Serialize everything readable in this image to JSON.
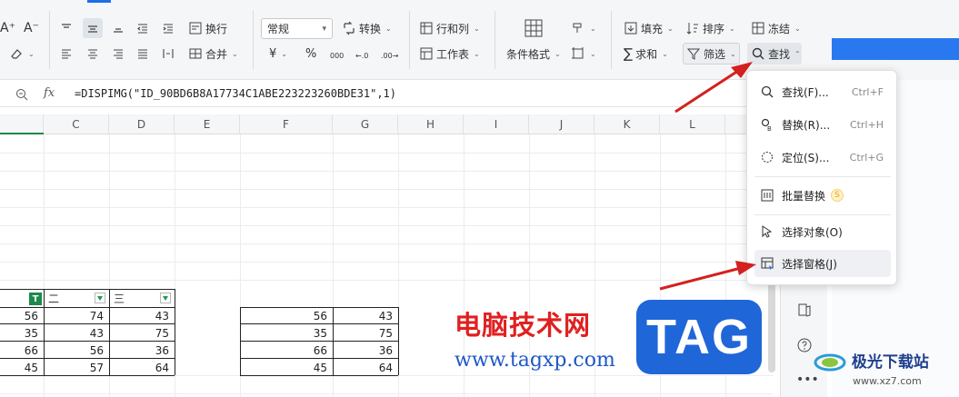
{
  "ribbon": {
    "wrap_text": "换行",
    "merge": "合并",
    "number_format": "常规",
    "convert": "转换",
    "row_col": "行和列",
    "worksheet": "工作表",
    "cond_format": "条件格式",
    "fill": "填充",
    "sort": "排序",
    "freeze": "冻结",
    "sum": "求和",
    "filter": "筛选",
    "find": "查找",
    "currency_symbol": "¥",
    "percent_symbol": "%"
  },
  "formula_bar": {
    "fx_label": "fx",
    "formula": "=DISPIMG(\"ID_90BD6B8A17734C1ABE223223260BDE31\",1)"
  },
  "columns": [
    "C",
    "D",
    "E",
    "F",
    "G",
    "H",
    "I",
    "J",
    "K",
    "L"
  ],
  "table_left": {
    "headers": [
      "二",
      "三"
    ],
    "rows": [
      [
        "56",
        "74",
        "43"
      ],
      [
        "35",
        "43",
        "75"
      ],
      [
        "66",
        "56",
        "36"
      ],
      [
        "45",
        "57",
        "64"
      ]
    ]
  },
  "table_right": {
    "rows": [
      [
        "56",
        "43"
      ],
      [
        "35",
        "75"
      ],
      [
        "66",
        "36"
      ],
      [
        "45",
        "64"
      ]
    ]
  },
  "find_menu": {
    "items": [
      {
        "label": "查找(F)...",
        "shortcut": "Ctrl+F",
        "icon": "search-icon"
      },
      {
        "label": "替换(R)...",
        "shortcut": "Ctrl+H",
        "icon": "replace-icon"
      },
      {
        "label": "定位(S)...",
        "shortcut": "Ctrl+G",
        "icon": "locate-icon"
      },
      {
        "label": "批量替换",
        "shortcut": "",
        "icon": "batch-replace-icon"
      },
      {
        "label": "选择对象(O)",
        "shortcut": "",
        "icon": "select-object-icon"
      },
      {
        "label": "选择窗格(J)",
        "shortcut": "",
        "icon": "selection-pane-icon"
      }
    ]
  },
  "watermark": {
    "cn": "电脑技术网",
    "url": "www.tagxp.com",
    "tag": "TAG",
    "logo": "极光下载站",
    "logo_url": "www.xz7.com"
  },
  "colors": {
    "accent_blue": "#1d6ee8",
    "arrow_red": "#d42020",
    "filter_green": "#1b8a4a"
  }
}
